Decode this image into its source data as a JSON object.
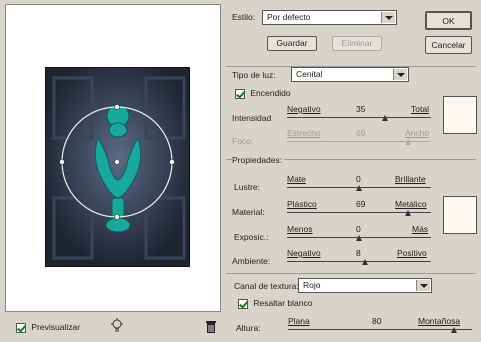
{
  "style": {
    "label": "Estilo:",
    "value": "Por defecto"
  },
  "buttons": {
    "ok": "OK",
    "cancel": "Cancelar",
    "save": "Guardar",
    "delete": "Eliminar"
  },
  "light": {
    "type_label": "Tipo de luz:",
    "type_value": "Cenital",
    "on_label": "Encendido",
    "on_checked": true,
    "intensity": {
      "label": "Intensidad",
      "min": "Negativo",
      "value": "35",
      "max": "Total",
      "level": 0.68
    },
    "focus": {
      "label": "Foco:",
      "min": "Estrecho",
      "value": "69",
      "max": "Ancho",
      "level": 0.84,
      "disabled": true
    }
  },
  "properties": {
    "title": "Propiedades:",
    "gloss": {
      "label": "Lustre:",
      "min": "Mate",
      "value": "0",
      "max": "Brillante",
      "level": 0.5
    },
    "material": {
      "label": "Material:",
      "min": "Plástico",
      "value": "69",
      "max": "Metálico",
      "level": 0.84
    },
    "exposure": {
      "label": "Exposic.:",
      "min": "Menos",
      "value": "0",
      "max": "Más",
      "level": 0.5
    },
    "ambience": {
      "label": "Ambiente:",
      "min": "Negativo",
      "value": "8",
      "max": "Positivo",
      "level": 0.54
    }
  },
  "texture": {
    "channel_label": "Canal de textura:",
    "channel_value": "Rojo",
    "white_high_label": "Resaltar blanco",
    "white_high_checked": true,
    "height": {
      "label": "Altura:",
      "min": "Plana",
      "value": "80",
      "max": "Montañosa",
      "level": 0.9
    }
  },
  "preview": {
    "label": "Previsualizar",
    "checked": true
  },
  "icons": {
    "light_bulb": "light-bulb-icon",
    "trash": "trash-icon"
  },
  "colors": {
    "background": "#d8d4cc",
    "light_ellipse": "#ffffff",
    "knocker": "#16a39a",
    "door": "#2a3140"
  }
}
